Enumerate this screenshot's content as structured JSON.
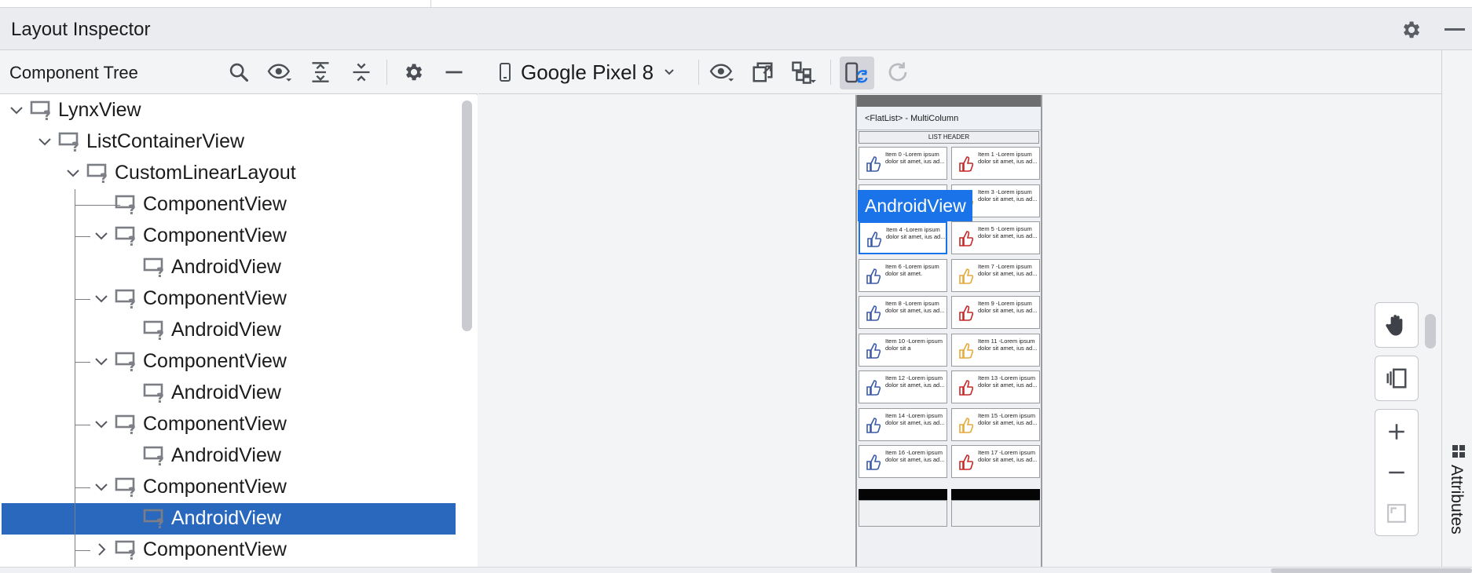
{
  "window": {
    "title": "Layout Inspector"
  },
  "component_tree": {
    "title": "Component Tree",
    "toolbar_icons": [
      "search-icon",
      "eye-icon",
      "expand-all-icon",
      "collapse-all-icon",
      "gear-icon",
      "minimize-icon"
    ],
    "nodes": [
      {
        "label": "LynxView",
        "depth": 0,
        "expander": "expanded"
      },
      {
        "label": "ListContainerView",
        "depth": 1,
        "expander": "expanded"
      },
      {
        "label": "CustomLinearLayout",
        "depth": 2,
        "expander": "expanded"
      },
      {
        "label": "ComponentView",
        "depth": 3,
        "expander": "none"
      },
      {
        "label": "ComponentView",
        "depth": 3,
        "expander": "expanded"
      },
      {
        "label": "AndroidView",
        "depth": 4,
        "expander": "none"
      },
      {
        "label": "ComponentView",
        "depth": 3,
        "expander": "expanded"
      },
      {
        "label": "AndroidView",
        "depth": 4,
        "expander": "none"
      },
      {
        "label": "ComponentView",
        "depth": 3,
        "expander": "expanded"
      },
      {
        "label": "AndroidView",
        "depth": 4,
        "expander": "none"
      },
      {
        "label": "ComponentView",
        "depth": 3,
        "expander": "expanded"
      },
      {
        "label": "AndroidView",
        "depth": 4,
        "expander": "none"
      },
      {
        "label": "ComponentView",
        "depth": 3,
        "expander": "expanded"
      },
      {
        "label": "AndroidView",
        "depth": 4,
        "expander": "none",
        "selected": true
      },
      {
        "label": "ComponentView",
        "depth": 3,
        "expander": "collapsed"
      }
    ]
  },
  "device_toolbar": {
    "device_name": "Google Pixel 8",
    "icons": [
      "phone-icon",
      "chevron-down-icon",
      "eye-icon",
      "export-layer-icon",
      "tree-options-icon",
      "live-update-icon",
      "refresh-icon"
    ]
  },
  "device_preview": {
    "app_title": "<FlatList> - MultiColumn",
    "list_header": "LIST HEADER",
    "highlight_label": "AndroidView",
    "items": [
      "Item 0 -Lorem ipsum dolor sit amet, ius ad...",
      "Item 1 -Lorem ipsum dolor sit amet, ius ad...",
      "",
      "Item 3 -Lorem ipsum dolor sit amet, ius ad...",
      "Item 4 -Lorem ipsum dolor sit amet, ius ad...",
      "Item 5 -Lorem ipsum dolor sit amet, ius ad...",
      "Item 6 -Lorem ipsum dolor sit amet.",
      "Item 7 -Lorem ipsum dolor sit amet, ius ad...",
      "Item 8 -Lorem ipsum dolor sit amet, ius ad...",
      "Item 9 -Lorem ipsum dolor sit amet, ius ad...",
      "Item 10 -Lorem ipsum dolor sit a",
      "Item 11 -Lorem ipsum dolor sit amet, ius ad...",
      "Item 12 -Lorem ipsum dolor sit amet, ius ad...",
      "Item 13 -Lorem ipsum dolor sit amet, ius ad...",
      "Item 14 -Lorem ipsum dolor sit amet, ius ad...",
      "Item 15 -Lorem ipsum dolor sit amet, ius ad...",
      "Item 16 -Lorem ipsum dolor sit amet, ius ad...",
      "Item 17 -Lorem ipsum dolor sit amet, ius ad..."
    ],
    "highlight_color": "#1a73e8"
  },
  "side_controls": [
    "pan-hand-icon",
    "layer-spacing-icon",
    "zoom-in-icon",
    "zoom-out-icon",
    "fit-screen-icon"
  ],
  "attributes_tab": {
    "label": "Attributes"
  },
  "colors": {
    "selection": "#2a68bd",
    "accent": "#1a73e8",
    "icon": "#5a5d63"
  }
}
